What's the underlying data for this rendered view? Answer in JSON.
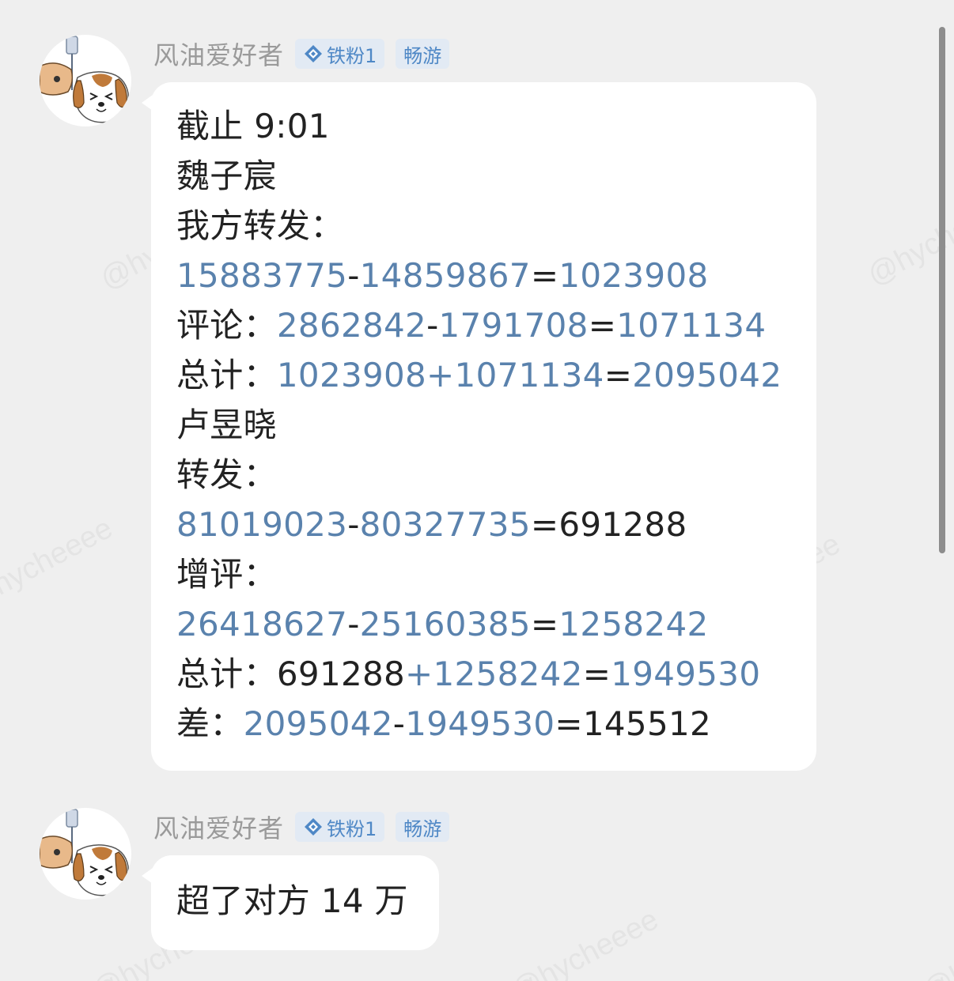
{
  "watermark": "@hycheeee",
  "colors": {
    "background": "#efefef",
    "bubble": "#ffffff",
    "text": "#222222",
    "number_link": "#5a82ad",
    "sender_name": "#9a9a9a",
    "badge_bg": "#e2eaf4",
    "badge_text": "#4f88c6"
  },
  "messages": [
    {
      "sender": {
        "name": "风油爱好者",
        "avatar_icon": "dog-avatar-icon",
        "badges": [
          {
            "icon": "diamond-icon",
            "label": "铁粉1"
          },
          {
            "label": "畅游"
          }
        ]
      },
      "lines": [
        [
          {
            "t": "截止 9:01",
            "c": "k"
          }
        ],
        [
          {
            "t": "魏子宸",
            "c": "k"
          }
        ],
        [
          {
            "t": "我方转发：",
            "c": "k"
          }
        ],
        [
          {
            "t": "15883775",
            "c": "n"
          },
          {
            "t": "-",
            "c": "k"
          },
          {
            "t": "14859867",
            "c": "n"
          },
          {
            "t": "=",
            "c": "k"
          },
          {
            "t": "1023908",
            "c": "n"
          }
        ],
        [
          {
            "t": "评论：",
            "c": "k"
          },
          {
            "t": "2862842",
            "c": "n"
          },
          {
            "t": "-",
            "c": "k"
          },
          {
            "t": "1791708",
            "c": "n"
          },
          {
            "t": "=",
            "c": "k"
          },
          {
            "t": "1071134",
            "c": "n"
          }
        ],
        [
          {
            "t": "总计：",
            "c": "k"
          },
          {
            "t": "1023908+1071134",
            "c": "n"
          },
          {
            "t": "=",
            "c": "k"
          },
          {
            "t": "2095042",
            "c": "n"
          }
        ],
        [
          {
            "t": "卢昱晓",
            "c": "k"
          }
        ],
        [
          {
            "t": "转发：",
            "c": "k"
          }
        ],
        [
          {
            "t": "81019023",
            "c": "n"
          },
          {
            "t": "-",
            "c": "k"
          },
          {
            "t": "80327735",
            "c": "n"
          },
          {
            "t": "=691288",
            "c": "k"
          }
        ],
        [
          {
            "t": "增评：",
            "c": "k"
          }
        ],
        [
          {
            "t": "26418627",
            "c": "n"
          },
          {
            "t": "-",
            "c": "k"
          },
          {
            "t": "25160385",
            "c": "n"
          },
          {
            "t": "=",
            "c": "k"
          },
          {
            "t": "1258242",
            "c": "n"
          }
        ],
        [
          {
            "t": "总计：691288",
            "c": "k"
          },
          {
            "t": "+1258242",
            "c": "n"
          },
          {
            "t": "=",
            "c": "k"
          },
          {
            "t": "1949530",
            "c": "n"
          }
        ],
        [
          {
            "t": "差：",
            "c": "k"
          },
          {
            "t": "2095042",
            "c": "n"
          },
          {
            "t": "-",
            "c": "k"
          },
          {
            "t": "1949530",
            "c": "n"
          },
          {
            "t": "=145512",
            "c": "k"
          }
        ]
      ]
    },
    {
      "sender": {
        "name": "风油爱好者",
        "avatar_icon": "dog-avatar-icon",
        "badges": [
          {
            "icon": "diamond-icon",
            "label": "铁粉1"
          },
          {
            "label": "畅游"
          }
        ]
      },
      "lines": [
        [
          {
            "t": "超了对方 14 万",
            "c": "k"
          }
        ]
      ]
    }
  ]
}
